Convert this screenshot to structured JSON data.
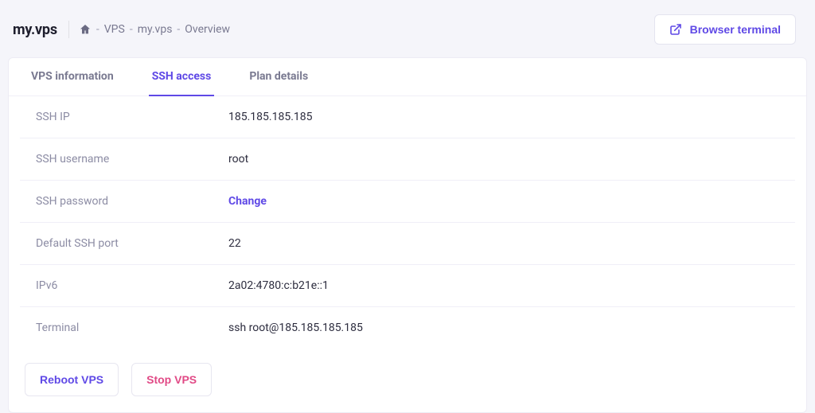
{
  "header": {
    "hostname": "my.vps",
    "breadcrumb": [
      "VPS",
      "my.vps",
      "Overview"
    ],
    "terminal_button": "Browser terminal"
  },
  "tabs": [
    {
      "label": "VPS information",
      "active": false
    },
    {
      "label": "SSH access",
      "active": true
    },
    {
      "label": "Plan details",
      "active": false
    }
  ],
  "rows": [
    {
      "label": "SSH IP",
      "value": "185.185.185.185"
    },
    {
      "label": "SSH username",
      "value": "root"
    },
    {
      "label": "SSH password",
      "value": "Change",
      "link": true
    },
    {
      "label": "Default SSH port",
      "value": "22"
    },
    {
      "label": "IPv6",
      "value": "2a02:4780:c:b21e::1"
    },
    {
      "label": "Terminal",
      "value": "ssh root@185.185.185.185"
    }
  ],
  "actions": {
    "reboot": "Reboot VPS",
    "stop": "Stop VPS"
  }
}
